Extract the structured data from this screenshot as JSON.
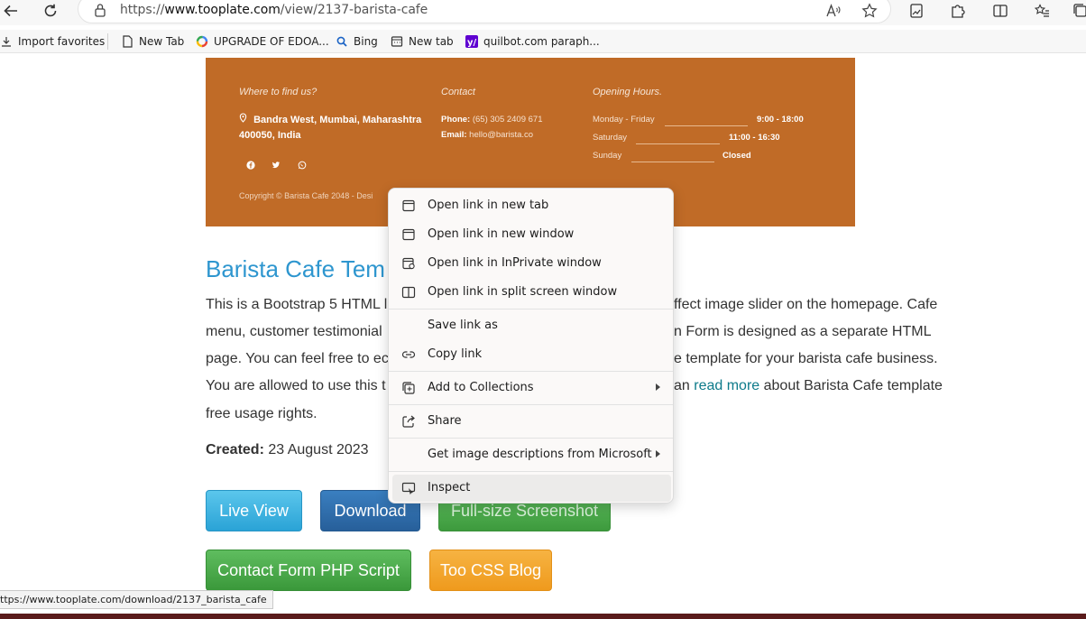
{
  "browser": {
    "url_prefix": "https://",
    "url_host": "www.tooplate.com",
    "url_path": "/view/2137-barista-cafe"
  },
  "favorites": [
    {
      "label": "Import favorites",
      "icon": "import-icon"
    },
    {
      "label": "New Tab",
      "icon": "page-icon"
    },
    {
      "label": "UPGRADE OF EDOA...",
      "icon": "colorful-ring-icon"
    },
    {
      "label": "Bing",
      "icon": "search-icon"
    },
    {
      "label": "New tab",
      "icon": "calendar-tab-icon"
    },
    {
      "label": "quilbot.com paraph...",
      "icon": "yahoo-icon"
    }
  ],
  "footer_preview": {
    "where_heading": "Where to find us?",
    "address_line1": "Bandra West, Mumbai, Maharashtra",
    "address_line2": "400050, India",
    "contact_heading": "Contact",
    "phone_label": "Phone:",
    "phone_value": "(65) 305 2409 671",
    "email_label": "Email:",
    "email_value": "hello@barista.co",
    "hours_heading": "Opening Hours.",
    "hours": [
      {
        "day": "Monday - Friday",
        "time": "9:00 - 18:00"
      },
      {
        "day": "Saturday",
        "time": "11:00 - 16:30"
      },
      {
        "day": "Sunday",
        "time": "Closed"
      }
    ],
    "copyright": "Copyright © Barista Cafe 2048 - Desi"
  },
  "content": {
    "title": "Barista Cafe Tem",
    "line1": "This is a Bootstrap 5 HTML l",
    "line1b": "ffect image slider on the homepage. Cafe",
    "line2": "menu, customer testimonial",
    "line2b": "n Form is designed as a separate HTML",
    "line3": "page. You can feel free to ec",
    "line3b": "e template for your barista cafe business.",
    "line4": "You are allowed to use this t",
    "line4b_prefix": "an ",
    "line4b_link": "read more",
    "line4b_suffix": " about Barista Cafe template",
    "line5": "free usage rights.",
    "created_label": "Created:",
    "created_value": " 23 August 2023"
  },
  "buttons": {
    "live_view": "Live View",
    "download": "Download",
    "full_size": "Full-size Screenshot",
    "contact_form": "Contact Form PHP Script",
    "css_blog": "Too CSS Blog"
  },
  "context_menu": {
    "items": [
      {
        "label": "Open link in new tab",
        "icon": "new-tab-icon"
      },
      {
        "label": "Open link in new window",
        "icon": "new-window-icon"
      },
      {
        "label": "Open link in InPrivate window",
        "icon": "inprivate-window-icon"
      },
      {
        "label": "Open link in split screen window",
        "icon": "split-screen-icon"
      },
      {
        "label": "Save link as",
        "icon": ""
      },
      {
        "label": "Copy link",
        "icon": "link-icon"
      },
      {
        "label": "Add to Collections",
        "icon": "collections-icon"
      },
      {
        "label": "Share",
        "icon": "share-icon"
      },
      {
        "label": "Get image descriptions from Microsoft",
        "icon": ""
      },
      {
        "label": "Inspect",
        "icon": "inspect-icon"
      }
    ]
  },
  "status_url": "ttps://www.tooplate.com/download/2137_barista_cafe",
  "colors": {
    "footer_bg": "#c06b27",
    "title_blue": "#2e96cf",
    "link_teal": "#0d7a8a"
  }
}
